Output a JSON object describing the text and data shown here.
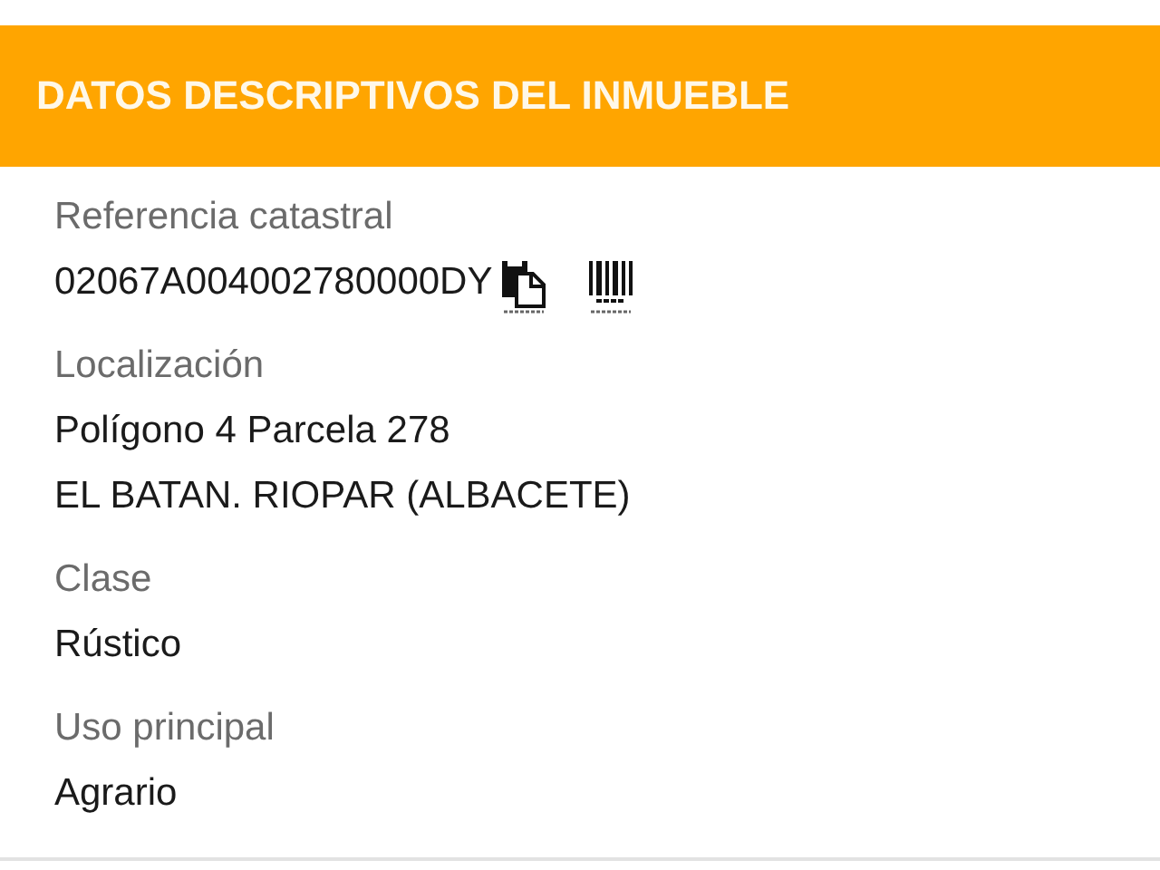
{
  "header": {
    "title": "DATOS DESCRIPTIVOS DEL INMUEBLE"
  },
  "fields": [
    {
      "kind": "reference",
      "label": "Referencia catastral",
      "values": [
        "02067A004002780000DY"
      ]
    },
    {
      "kind": "text",
      "label": "Localización",
      "values": [
        "Polígono 4 Parcela 278",
        "EL BATAN. RIOPAR (ALBACETE)"
      ]
    },
    {
      "kind": "text",
      "label": "Clase",
      "values": [
        "Rústico"
      ]
    },
    {
      "kind": "text",
      "label": "Uso principal",
      "values": [
        "Agrario"
      ]
    }
  ]
}
